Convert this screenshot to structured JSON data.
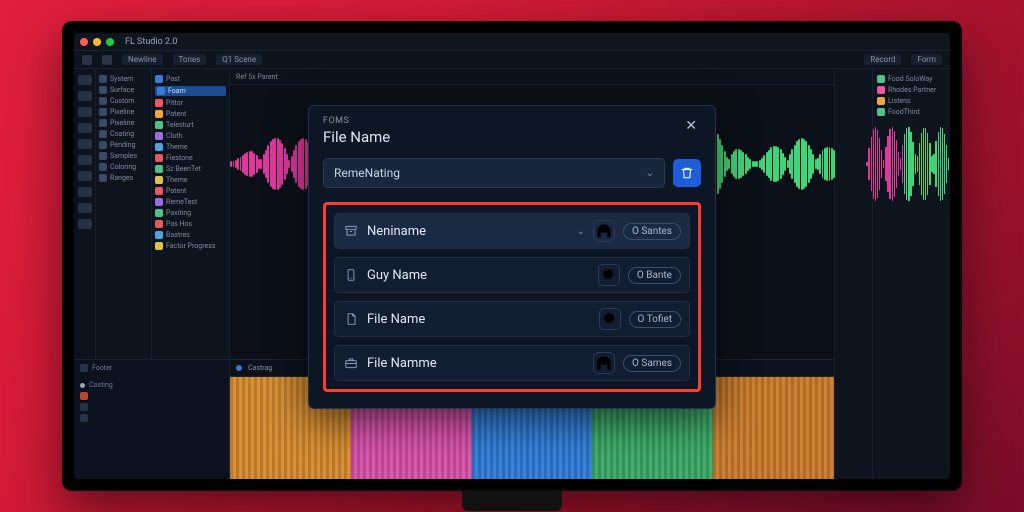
{
  "app": {
    "title": "FL Studio 2.0"
  },
  "toolstrip": {
    "breadcrumb_a": "Newline",
    "breadcrumb_b": "Tones",
    "breadcrumb_c": "Q1 Scene",
    "tab_a": "Record",
    "tab_b": "Form"
  },
  "sidebar_left": {
    "items": [
      {
        "label": "System",
        "color": "#3a4a62"
      },
      {
        "label": "Surface",
        "color": "#3a4a62"
      },
      {
        "label": "Custom",
        "color": "#3a4a62"
      },
      {
        "label": "Pixeline",
        "color": "#3a4a62"
      },
      {
        "label": "Pixeline",
        "color": "#3a4a62"
      },
      {
        "label": "Coating",
        "color": "#3a4a62"
      },
      {
        "label": "Pending",
        "color": "#3a4a62"
      },
      {
        "label": "Samples",
        "color": "#3a4a62"
      },
      {
        "label": "Coloring",
        "color": "#3a4a62"
      },
      {
        "label": "Ranges",
        "color": "#3a4a62"
      }
    ]
  },
  "sidebar_browser": {
    "items": [
      {
        "label": "Past",
        "color": "#3a7bd5"
      },
      {
        "label": "Foam",
        "color": "#3a7bd5",
        "active": true
      },
      {
        "label": "Pittor",
        "color": "#e85a5a"
      },
      {
        "label": "Patent",
        "color": "#f2a63a"
      },
      {
        "label": "Telesturt",
        "color": "#52c08a"
      },
      {
        "label": "Cloth",
        "color": "#9a6ee2"
      },
      {
        "label": "Theme",
        "color": "#4aa3e0"
      },
      {
        "label": "Fiestone",
        "color": "#e85a5a"
      },
      {
        "label": "Sz BeenTet",
        "color": "#52c08a"
      },
      {
        "label": "Theme",
        "color": "#e0c24a"
      },
      {
        "label": "Patent",
        "color": "#e85a5a"
      },
      {
        "label": "RemeTest",
        "color": "#9a6ee2"
      },
      {
        "label": "Paxiting",
        "color": "#52c08a"
      },
      {
        "label": "Pas Hos",
        "color": "#e85a5a"
      },
      {
        "label": "Baatres",
        "color": "#4aa3e0"
      },
      {
        "label": "Factor Progress",
        "color": "#e0c24a"
      }
    ]
  },
  "sidebar_right": {
    "items": [
      {
        "label": "Food SoloWay",
        "color": "#52c08a"
      },
      {
        "label": "Rhodes Partner",
        "color": "#e85aa0"
      },
      {
        "label": "Listens",
        "color": "#f2a63a"
      },
      {
        "label": "FoodThird",
        "color": "#52c08a"
      }
    ]
  },
  "mixer": {
    "header": "Footer",
    "track": "Casting",
    "row1": "Ref 5x Parent"
  },
  "modal": {
    "eyebrow": "FOMS",
    "title": "File Name",
    "select_value": "RemeNating",
    "rows": [
      {
        "icon": "archive",
        "label": "Neniname",
        "chev": true,
        "btn_icon": "headphones",
        "pill": "O Santes",
        "hi": true
      },
      {
        "icon": "phone",
        "label": "Guy Name",
        "chev": false,
        "btn_icon": "search",
        "pill": "O Bante"
      },
      {
        "icon": "file",
        "label": "File Name",
        "chev": false,
        "btn_icon": "search",
        "pill": "O Tofiet"
      },
      {
        "icon": "briefcase",
        "label": "File Namme",
        "chev": false,
        "btn_icon": "headphones",
        "pill": "O Sames"
      }
    ]
  },
  "timeline_row": "Castrag",
  "clips": [
    {
      "color": "#d58a2e"
    },
    {
      "color": "#d64fa9"
    },
    {
      "color": "#2e7bd6"
    },
    {
      "color": "#3aa866"
    },
    {
      "color": "#c97a2a"
    }
  ]
}
